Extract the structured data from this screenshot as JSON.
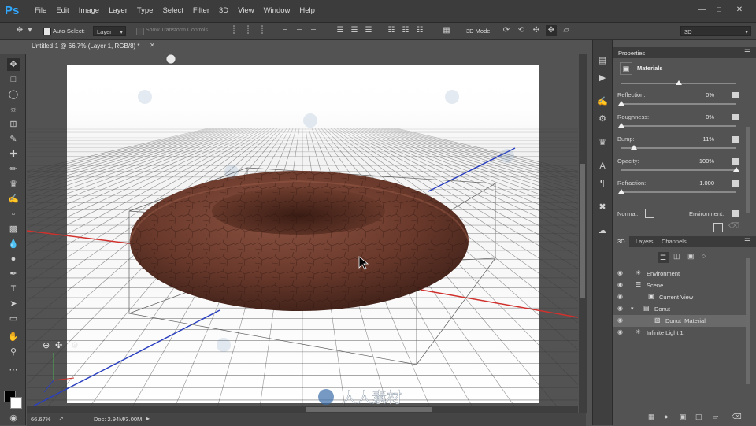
{
  "app": {
    "logo": "Ps"
  },
  "menu": [
    "File",
    "Edit",
    "Image",
    "Layer",
    "Type",
    "Select",
    "Filter",
    "3D",
    "View",
    "Window",
    "Help"
  ],
  "options_bar": {
    "auto_select_label": "Auto-Select:",
    "auto_select_value": "Layer",
    "show_transform_label": "Show Transform Controls",
    "mode_label": "3D Mode:",
    "workspace_value": "3D"
  },
  "document": {
    "tab_title": "Untitled-1 @ 66.7% (Layer 1, RGB/8) *",
    "zoom": "66.67%",
    "doc_size": "Doc: 2.94M/3.00M"
  },
  "watermark": {
    "text": "人人素材"
  },
  "properties": {
    "panel_title": "Properties",
    "section_title": "Materials",
    "rows": [
      {
        "label": "Reflection:",
        "value": "0%",
        "level": 0
      },
      {
        "label": "Roughness:",
        "value": "0%",
        "level": 0
      },
      {
        "label": "Bump:",
        "value": "11%",
        "level": 0.11
      },
      {
        "label": "Opacity:",
        "value": "100%",
        "level": 1
      },
      {
        "label": "Refraction:",
        "value": "1.000",
        "level": 0
      }
    ],
    "normal_label": "Normal:",
    "environment_label": "Environment:"
  },
  "panel3d": {
    "tabs": [
      "3D",
      "Layers",
      "Channels"
    ],
    "scene_items": [
      {
        "label": "Environment",
        "selected": false
      },
      {
        "label": "Scene",
        "selected": false
      },
      {
        "label": "Current View",
        "selected": false
      },
      {
        "label": "Donut",
        "selected": false
      },
      {
        "label": "Donut_Material",
        "selected": true
      },
      {
        "label": "Infinite Light 1",
        "selected": false
      }
    ]
  },
  "colors": {
    "donut": "#6b3a2c",
    "x_axis": "#d0312d",
    "z_axis": "#2a3fbf",
    "accent": "#31a8ff"
  }
}
